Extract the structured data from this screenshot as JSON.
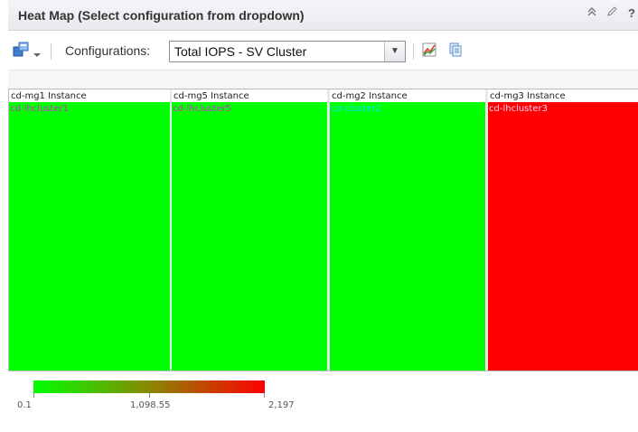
{
  "window": {
    "title": "Heat Map (Select configuration from dropdown)",
    "icons": [
      "collapse-icon",
      "edit-icon",
      "help-icon"
    ]
  },
  "toolbar": {
    "configurations_label": "Configurations:",
    "selected_configuration": "Total IOPS - SV Cluster",
    "icons": [
      "layout-icon",
      "dropdown-icon",
      "chart-icon",
      "copy-icon"
    ]
  },
  "heatmap": {
    "columns": [
      {
        "header": "cd-mg1 Instance",
        "cell_label": "cd-lhcluster1",
        "cell_color": "#00ff00",
        "label_color": "#cc33cc"
      },
      {
        "header": "cd-mg5 Instance",
        "cell_label": "cd-lhcluster5",
        "cell_color": "#00ff00",
        "label_color": "#cc33cc"
      },
      {
        "header": "cd-mg2 Instance",
        "cell_label": "cd-cluster2",
        "cell_color": "#00ff00",
        "label_color": "#00e5ff"
      },
      {
        "header": "cd-mg3 Instance",
        "cell_label": "cd-lhcluster3",
        "cell_color": "#ff0000",
        "label_color": "#ffd6f0"
      }
    ]
  },
  "legend": {
    "min_label": "0.1",
    "mid_label": "1,098.55",
    "max_label": "2,197",
    "colors": {
      "low": "#00ff00",
      "mid": "#888800",
      "high": "#ff0000"
    }
  }
}
